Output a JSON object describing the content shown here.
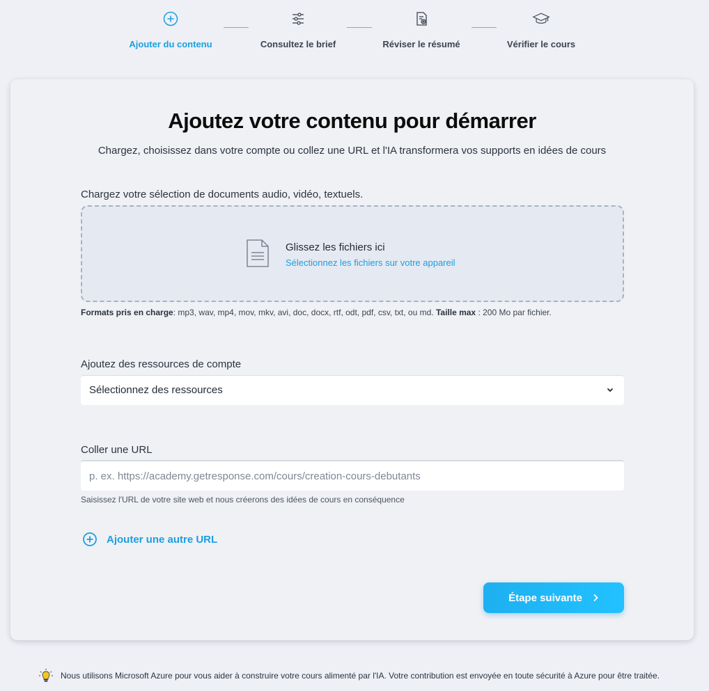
{
  "stepper": {
    "steps": [
      {
        "label": "Ajouter du contenu",
        "icon": "plus-circle-icon",
        "active": true
      },
      {
        "label": "Consultez le brief",
        "icon": "sliders-icon",
        "active": false
      },
      {
        "label": "Réviser le résumé",
        "icon": "document-review-icon",
        "active": false
      },
      {
        "label": "Vérifier le cours",
        "icon": "graduation-cap-icon",
        "active": false
      }
    ]
  },
  "main": {
    "title": "Ajoutez votre contenu pour démarrer",
    "subtitle": "Chargez, choisissez dans votre compte ou collez une URL et l'IA transformera vos supports en idées de cours"
  },
  "upload": {
    "label": "Chargez votre sélection de documents audio, vidéo, textuels.",
    "drop_title": "Glissez les fichiers ici",
    "drop_link": "Sélectionnez les fichiers sur votre appareil",
    "formats_label": "Formats pris en charge",
    "formats_value": ": mp3, wav, mp4, mov, mkv, avi, doc, docx, rtf, odt, pdf, csv, txt, ou md.",
    "maxsize_label": "Taille max",
    "maxsize_value": ": 200 Mo par fichier."
  },
  "resources": {
    "label": "Ajoutez des ressources de compte",
    "selected": "Sélectionnez des ressources"
  },
  "url": {
    "label": "Coller une URL",
    "placeholder": "p. ex. https://academy.getresponse.com/cours/creation-cours-debutants",
    "value": "",
    "hint": "Saisissez l'URL de votre site web et nous créerons des idées de cours en conséquence",
    "add_label": "Ajouter une autre URL"
  },
  "actions": {
    "next_label": "Étape suivante"
  },
  "footer": {
    "note": "Nous utilisons Microsoft Azure pour vous aider à construire votre cours alimenté par l'IA. Votre contribution est envoyée en toute sécurité à Azure pour être traitée."
  },
  "colors": {
    "accent": "#1a9fe0",
    "background": "#eef0f5",
    "card": "#f0f1f5",
    "button": "#22b8f5"
  }
}
